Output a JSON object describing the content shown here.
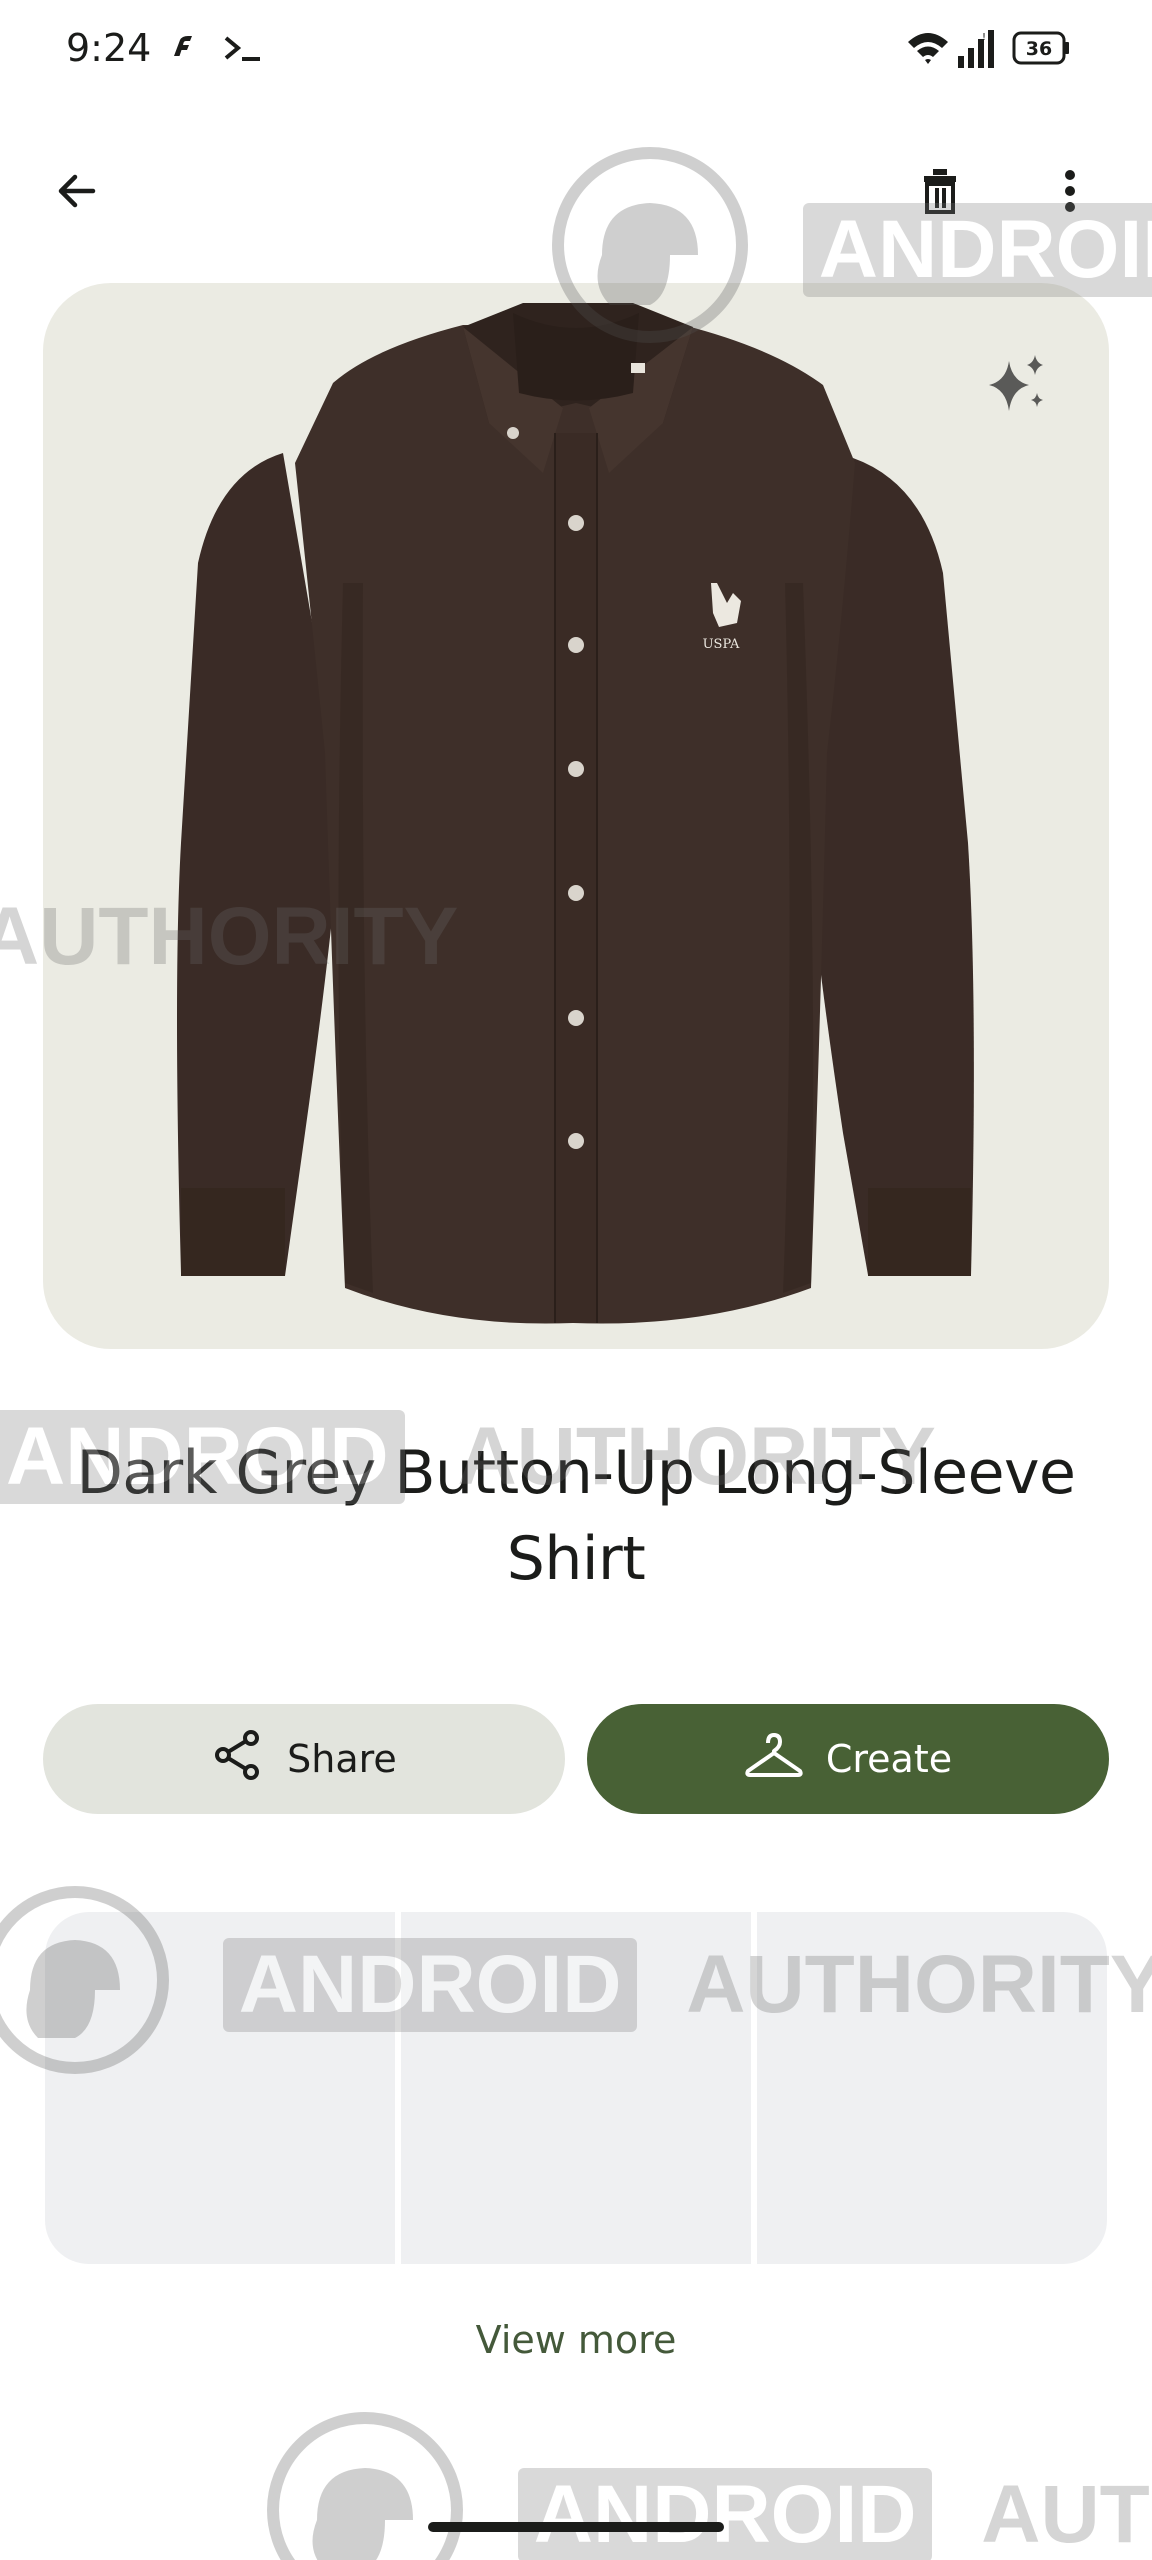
{
  "status_bar": {
    "time": "9:24",
    "battery": "36",
    "icons": [
      "notification-f-icon",
      "terminal-icon",
      "wifi-icon",
      "signal-icon",
      "battery-icon"
    ]
  },
  "app_bar": {
    "back_icon": "arrow-back-icon",
    "delete_icon": "trash-icon",
    "more_icon": "more-vert-icon"
  },
  "product": {
    "image_alt": "shirt-image",
    "logo_text": "USPA",
    "title_line1": "Dark Grey Button-Up Long-Sleeve",
    "title_line2": "Shirt"
  },
  "actions": {
    "share_label": "Share",
    "create_label": "Create"
  },
  "view_more_label": "View more",
  "watermark": {
    "brand_a": "ANDROID",
    "brand_b": "AUTHORITY"
  },
  "colors": {
    "hero_bg": "#ebebe3",
    "create_bg": "#486135",
    "share_bg": "#e2e4dd",
    "accent_text": "#44593a"
  }
}
